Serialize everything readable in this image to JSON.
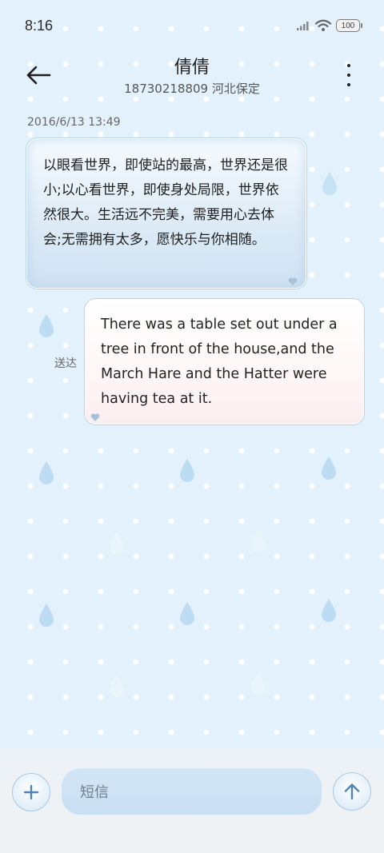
{
  "status_bar": {
    "time": "8:16",
    "battery": "100",
    "signal_icon": "cellular-signal-icon",
    "wifi_icon": "wifi-icon"
  },
  "header": {
    "contact_name": "倩倩",
    "contact_detail": "18730218809 河北保定",
    "back_icon": "back-arrow-icon",
    "more_icon": "more-vertical-icon"
  },
  "conversation": {
    "timestamp": "2016/6/13 13:49",
    "messages": [
      {
        "direction": "incoming",
        "text": "以眼看世界，即使站的最高，世界还是很小;以心看世界，即使身处局限，世界依然很大。生活远不完美，需要用心去体会;无需拥有太多，愿快乐与你相随。"
      },
      {
        "direction": "outgoing",
        "text": "There was a table set out under a tree in front of the house,and the March Hare and the Hatter were having tea at it.",
        "status": "送达"
      }
    ]
  },
  "composer": {
    "placeholder": "短信",
    "add_icon": "plus-icon",
    "send_icon": "send-arrow-up-icon"
  },
  "colors": {
    "background": "#e2f1fb",
    "accent": "#a9c8e2",
    "input": "#cde2f4"
  }
}
